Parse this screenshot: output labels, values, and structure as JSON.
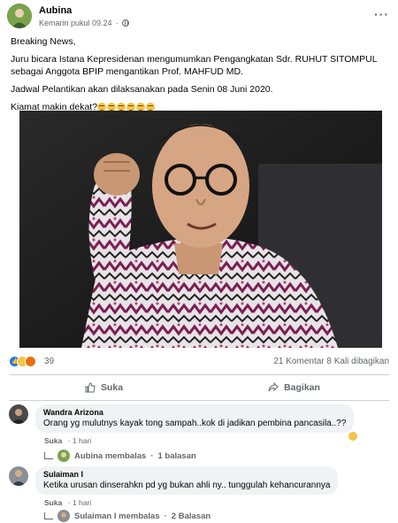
{
  "post": {
    "author": "Aubina",
    "time": "Kemarin pukul 09.24",
    "more_label": "···",
    "paragraphs": [
      "Breaking News,",
      "Juru bicara Istana Kepresidenan mengumumkan Pengangkatan Sdr. RUHUT SITOMPUL sebagai Anggota BPIP mengantikan Prof. MAHFUD MD.",
      "Jadwal Pelantikan akan dilaksanakan pada Senin 08 Juni 2020."
    ],
    "last_line": "Kiamat makin dekat?",
    "emoji_count": 6
  },
  "stats": {
    "reaction_count": "39",
    "comments_shares": "21 Komentar  8 Kali dibagikan"
  },
  "actions": {
    "like_label": "Suka",
    "share_label": "Bagikan"
  },
  "comments": [
    {
      "name": "Wandra Arizona",
      "text": "Orang yg mulutnys kayak tong sampah..kok di jadikan pembina pancasila..??",
      "like": "Suka",
      "age": "1 hari",
      "reply_by": "Aubina membalas",
      "replies": "1 balasan"
    },
    {
      "name": "Sulaiman I",
      "text": "Ketika urusan dinserahkn pd yg bukan ahli ny.. tunggulah kehancurannya",
      "like": "Suka",
      "age": "1 hari",
      "reply_by": "Sulaiman I membalas",
      "replies": "2 Balasan"
    }
  ],
  "colors": {
    "accent": "#1877f2",
    "secondary_text": "#65676b",
    "bubble": "#f0f2f5"
  }
}
